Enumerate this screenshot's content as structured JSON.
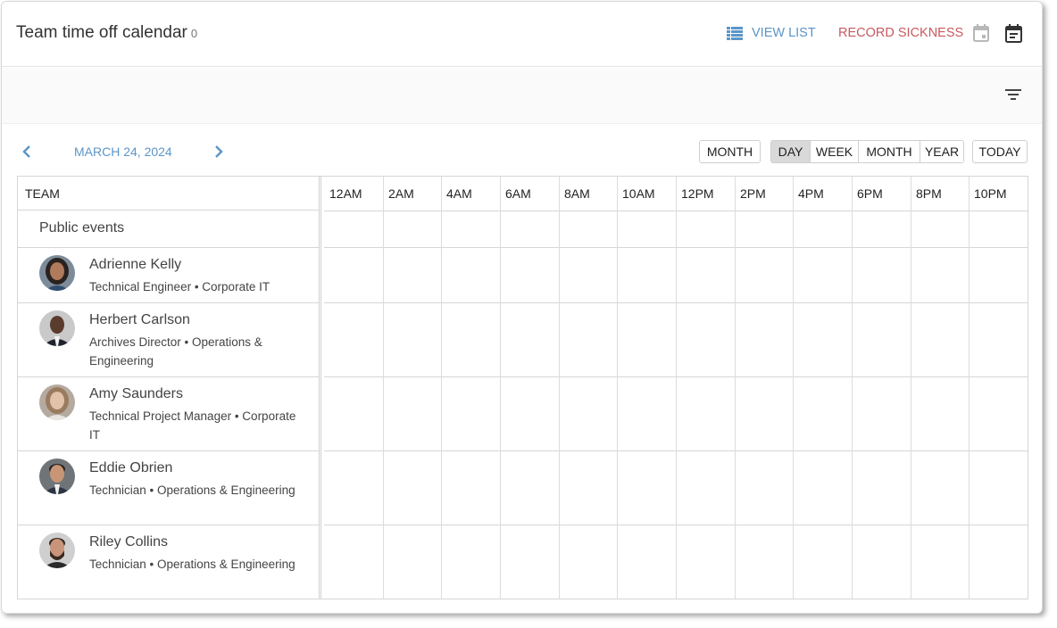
{
  "header": {
    "title": "Team time off calendar",
    "count": "0",
    "view_list": "VIEW LIST",
    "record_sickness": "RECORD SICKNESS"
  },
  "nav": {
    "date": "MARCH 24, 2024",
    "month_single": "MONTH",
    "views": [
      "DAY",
      "WEEK",
      "MONTH",
      "YEAR"
    ],
    "active_view": "DAY",
    "today": "TODAY"
  },
  "grid": {
    "team_header": "TEAM",
    "time_labels": [
      "12AM",
      "2AM",
      "4AM",
      "6AM",
      "8AM",
      "10AM",
      "12PM",
      "2PM",
      "4PM",
      "6PM",
      "8PM",
      "10PM"
    ],
    "public_events": "Public events",
    "members": [
      {
        "name": "Adrienne Kelly",
        "desc": "Technical Engineer • Corporate IT"
      },
      {
        "name": "Herbert Carlson",
        "desc": "Archives Director • Operations & Engineering"
      },
      {
        "name": "Amy Saunders",
        "desc": "Technical Project Manager • Corporate IT"
      },
      {
        "name": "Eddie Obrien",
        "desc": "Technician • Operations & Engineering"
      },
      {
        "name": "Riley Collins",
        "desc": "Technician • Operations & Engineering"
      }
    ]
  },
  "colors": {
    "link_blue": "#5b95c9",
    "sickness_red": "#c85a5f",
    "active_segment": "#d9d9d9"
  }
}
